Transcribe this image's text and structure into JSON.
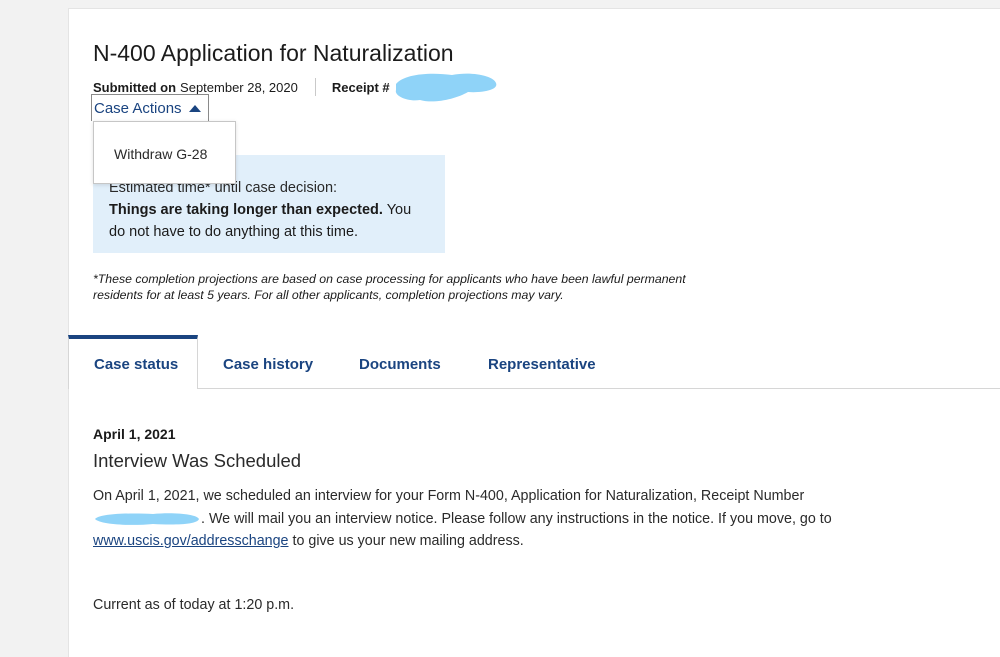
{
  "application": {
    "title": "N-400 Application for Naturalization",
    "submitted_label": "Submitted on",
    "submitted_date": "September 28, 2020",
    "receipt_label": "Receipt #"
  },
  "case_actions": {
    "label": "Case Actions",
    "menu_items": [
      "Withdraw G-28"
    ]
  },
  "estimate": {
    "partial_text": "Estimated time* until case decision:",
    "bold_text": "Things are taking longer than expected.",
    "rest_text": " You do not have to do anything at this time."
  },
  "footnote": "*These completion projections are based on case processing for applicants who have been lawful permanent residents for at least 5 years. For all other applicants, completion projections may vary.",
  "tabs": [
    {
      "label": "Case status",
      "active": true
    },
    {
      "label": "Case history",
      "active": false
    },
    {
      "label": "Documents",
      "active": false
    },
    {
      "label": "Representative",
      "active": false
    }
  ],
  "event": {
    "date": "April 1, 2021",
    "title": "Interview Was Scheduled",
    "body_part1": "On April 1, 2021, we scheduled an interview for your Form N-400, Application for Naturalization, Receipt Number ",
    "body_part2": ". We will mail you an interview notice. Please follow any instructions in the notice. If you move, go to ",
    "link_text": "www.uscis.gov/addresschange",
    "body_part3": " to give us your new mailing address."
  },
  "current_as_of": "Current as of today at 1:20 p.m.",
  "colors": {
    "link_blue": "#1a4480",
    "info_bg": "#e1effa",
    "redaction": "#8fd3f8"
  }
}
